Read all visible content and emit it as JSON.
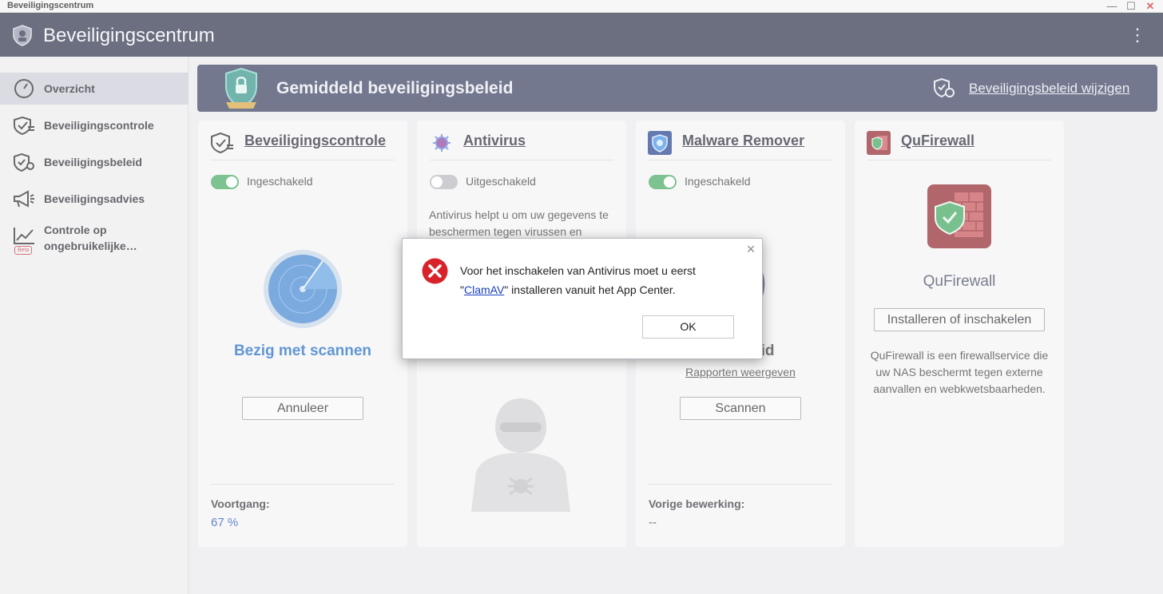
{
  "os": {
    "title": "Beveiligingscentrum",
    "minimize": "—",
    "maximize": "☐",
    "close": "✕"
  },
  "header": {
    "title": "Beveiligingscentrum",
    "menu_icon": "⋮"
  },
  "sidebar": {
    "items": [
      {
        "label": "Overzicht",
        "icon": "gauge-icon"
      },
      {
        "label": "Beveiligingscontrole",
        "icon": "shield-check-icon"
      },
      {
        "label": "Beveiligingsbeleid",
        "icon": "shield-gear-icon"
      },
      {
        "label": "Beveiligingsadvies",
        "icon": "megaphone-icon"
      },
      {
        "label_line1": "Controle op",
        "label_line2": "ongebruikelijke…",
        "icon": "chart-line-icon",
        "badge": "Beta"
      }
    ]
  },
  "banner": {
    "title": "Gemiddeld beveiligingsbeleid",
    "link": "Beveiligingsbeleid wijzigen"
  },
  "cards": {
    "security_check": {
      "title": "Beveiligingscontrole",
      "toggle_label": "Ingeschakeld",
      "status": "Bezig met scannen",
      "button": "Annuleer",
      "footer_label": "Voortgang:",
      "footer_value": "67 %"
    },
    "antivirus": {
      "title": "Antivirus",
      "toggle_label": "Uitgeschakeld",
      "desc_line1": "Antivirus helpt u om uw gegevens te",
      "desc_line2": "beschermen tegen virussen en"
    },
    "malware": {
      "title": "Malware Remover",
      "toggle_label": "Ingeschakeld",
      "status_partial": "oid",
      "link": "Rapporten weergeven",
      "button": "Scannen",
      "footer_label": "Vorige bewerking:",
      "footer_value": "--"
    },
    "firewall": {
      "title": "QuFirewall",
      "app_name": "QuFirewall",
      "button": "Installeren of inschakelen",
      "desc_line1": "QuFirewall is een firewallservice die",
      "desc_line2": "uw NAS beschermt tegen externe",
      "desc_line3": "aanvallen en webkwetsbaarheden."
    }
  },
  "dialog": {
    "line1": "Voor het inschakelen van Antivirus moet u eerst",
    "quote_open": "\"",
    "link": "ClamAV",
    "quote_close": "\"",
    "line2_rest": " installeren vanuit het App Center.",
    "ok": "OK",
    "close": "×"
  },
  "colors": {
    "header": "#262b44",
    "banner": "#32385a",
    "accent_blue": "#1565c0",
    "toggle_on": "#40a55e",
    "error_red": "#d8232a"
  }
}
